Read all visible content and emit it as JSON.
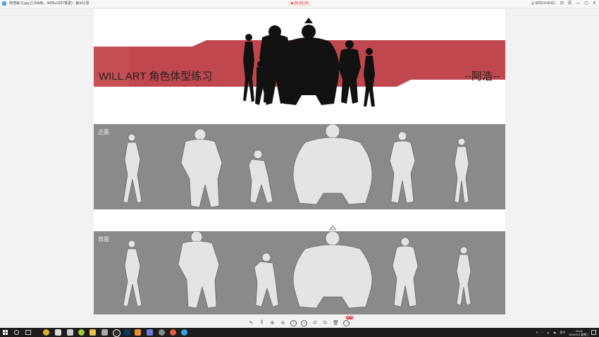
{
  "window": {
    "title": "阿浩练习.jpg (1.56MB，4406x3267像素) - 第4/11张",
    "recording_time": "00:53:15",
    "user": "WIS141641...",
    "controls": [
      "♡",
      "⊡",
      "☰",
      "—",
      "▢",
      "✕"
    ]
  },
  "artwork": {
    "title": "WILL ART 角色体型练习",
    "author": "--阿浩--",
    "front_label": "正面",
    "back_label": "背面",
    "colors": {
      "banner": "#c0474d",
      "panel": "#8a8a8a",
      "figure": "#e4e4e4",
      "silhouette": "#111111"
    }
  },
  "viewer_toolbar": {
    "tools": [
      {
        "name": "edit-icon",
        "glyph": "✎"
      },
      {
        "name": "compare-icon",
        "glyph": "⫴"
      },
      {
        "name": "zoom-in-icon",
        "glyph": "⊕"
      },
      {
        "name": "zoom-out-icon",
        "glyph": "⊖"
      },
      {
        "name": "prev-icon",
        "glyph": "‹"
      },
      {
        "name": "next-icon",
        "glyph": "›"
      },
      {
        "name": "rotate-left-icon",
        "glyph": "↺"
      },
      {
        "name": "rotate-right-icon",
        "glyph": "↻"
      },
      {
        "name": "delete-icon",
        "glyph": "🗑"
      },
      {
        "name": "more-icon",
        "glyph": "⋯"
      }
    ],
    "badge": "NEW"
  },
  "taskbar": {
    "time": "20:08",
    "date": "2019/1/3 星期三",
    "ime": "简中"
  }
}
